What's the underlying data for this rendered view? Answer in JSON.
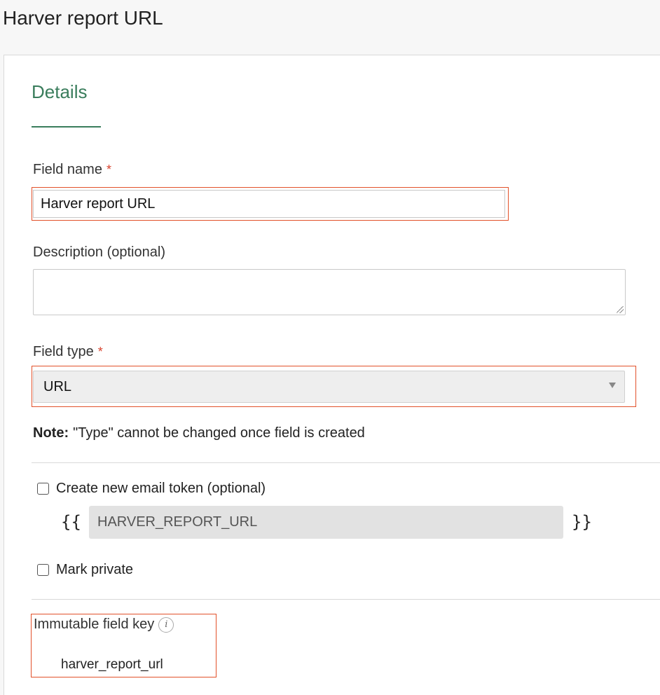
{
  "page": {
    "title": "Harver report URL"
  },
  "details": {
    "section_title": "Details",
    "field_name": {
      "label": "Field name",
      "required_mark": "*",
      "value": "Harver report URL"
    },
    "description": {
      "label": "Description (optional)",
      "value": ""
    },
    "field_type": {
      "label": "Field type",
      "required_mark": "*",
      "selected": "URL"
    },
    "note": {
      "bold": "Note:",
      "text": "\"Type\" cannot be changed once field is created"
    },
    "email_token": {
      "label": "Create new email token (optional)",
      "checked": false,
      "open_brace": "{{",
      "close_brace": "}}",
      "value": "HARVER_REPORT_URL"
    },
    "mark_private": {
      "label": "Mark private",
      "checked": false
    },
    "immutable_key": {
      "label": "Immutable field key",
      "info_glyph": "i",
      "value": "harver_report_url"
    }
  },
  "colors": {
    "accent_green": "#3a7d5c",
    "highlight_orange": "#e2512a",
    "required_red": "#d9432e"
  }
}
